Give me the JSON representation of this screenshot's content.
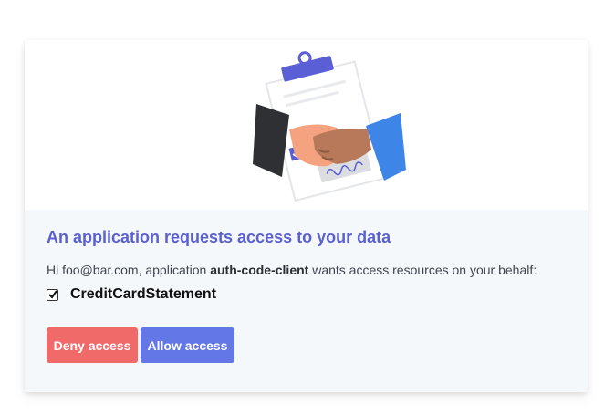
{
  "consent": {
    "title": "An application requests access to your data",
    "intro": {
      "prefix": "Hi foo@bar.com, application ",
      "client_name": "auth-code-client",
      "suffix": " wants access resources on your behalf:"
    },
    "scopes": [
      {
        "label": "CreditCardStatement",
        "checked": true
      }
    ],
    "buttons": {
      "deny_label": "Deny access",
      "allow_label": "Allow access"
    }
  },
  "illustration": {
    "icon": "handshake-contract-illustration"
  },
  "colors": {
    "title": "#5a60cf",
    "deny": "#f06a6a",
    "allow": "#6377e6",
    "panel": "#f5f8fb"
  }
}
